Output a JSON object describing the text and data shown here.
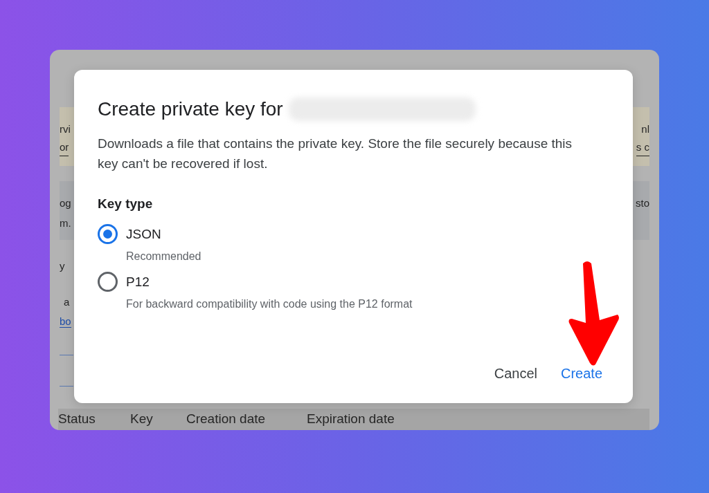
{
  "background": {
    "notice": [
      {
        "left": "rvi",
        "right": "nl",
        "underlined": false
      },
      {
        "left": "or",
        "right": "s c",
        "underlined": true
      }
    ],
    "info": [
      {
        "left": "og",
        "right": "sto"
      },
      {
        "left": "m."
      }
    ],
    "fragments": [
      {
        "text": "y",
        "kind": "text"
      },
      {
        "text": "a",
        "kind": "text"
      },
      {
        "text": "bo",
        "kind": "link"
      }
    ],
    "table": {
      "columns": [
        "Status",
        "Key",
        "Creation date",
        "Expiration date"
      ]
    }
  },
  "dialog": {
    "title": "Create private key for",
    "title_redacted": true,
    "description": "Downloads a file that contains the private key. Store the file securely because this key can't be recovered if lost.",
    "group_label": "Key type",
    "options": [
      {
        "label": "JSON",
        "hint": "Recommended",
        "selected": true
      },
      {
        "label": "P12",
        "hint": "For backward compatibility with code using the P12 format",
        "selected": false
      }
    ],
    "buttons": [
      {
        "label": "Cancel",
        "kind": "text"
      },
      {
        "label": "Create",
        "kind": "primary"
      }
    ]
  },
  "annotation": {
    "kind": "arrow"
  }
}
